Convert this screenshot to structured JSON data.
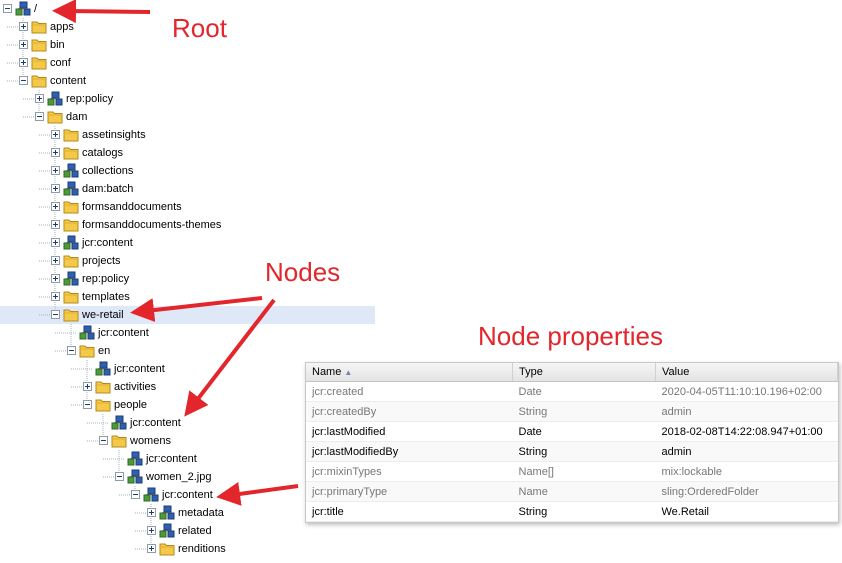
{
  "tree": {
    "nodes": [
      {
        "label": "/",
        "icon": "node-icon",
        "toggle": "minus"
      },
      {
        "label": "apps",
        "icon": "folder-icon",
        "toggle": "plus"
      },
      {
        "label": "bin",
        "icon": "folder-icon",
        "toggle": "plus"
      },
      {
        "label": "conf",
        "icon": "folder-icon",
        "toggle": "plus"
      },
      {
        "label": "content",
        "icon": "folder-icon",
        "toggle": "minus"
      },
      {
        "label": "rep:policy",
        "icon": "node-icon",
        "toggle": "plus"
      },
      {
        "label": "dam",
        "icon": "folder-icon",
        "toggle": "minus"
      },
      {
        "label": "assetinsights",
        "icon": "folder-icon",
        "toggle": "plus"
      },
      {
        "label": "catalogs",
        "icon": "folder-icon",
        "toggle": "plus"
      },
      {
        "label": "collections",
        "icon": "node-icon",
        "toggle": "plus"
      },
      {
        "label": "dam:batch",
        "icon": "node-icon",
        "toggle": "plus"
      },
      {
        "label": "formsanddocuments",
        "icon": "folder-icon",
        "toggle": "plus"
      },
      {
        "label": "formsanddocuments-themes",
        "icon": "folder-icon",
        "toggle": "plus"
      },
      {
        "label": "jcr:content",
        "icon": "node-icon",
        "toggle": "plus"
      },
      {
        "label": "projects",
        "icon": "folder-icon",
        "toggle": "plus"
      },
      {
        "label": "rep:policy",
        "icon": "node-icon",
        "toggle": "plus"
      },
      {
        "label": "templates",
        "icon": "folder-icon",
        "toggle": "plus"
      },
      {
        "label": "we-retail",
        "icon": "folder-icon",
        "toggle": "minus"
      },
      {
        "label": "jcr:content",
        "icon": "node-icon",
        "toggle": "none"
      },
      {
        "label": "en",
        "icon": "folder-icon",
        "toggle": "minus"
      },
      {
        "label": "jcr:content",
        "icon": "node-icon",
        "toggle": "none"
      },
      {
        "label": "activities",
        "icon": "folder-icon",
        "toggle": "plus"
      },
      {
        "label": "people",
        "icon": "folder-icon",
        "toggle": "minus"
      },
      {
        "label": "jcr:content",
        "icon": "node-icon",
        "toggle": "none"
      },
      {
        "label": "womens",
        "icon": "folder-icon",
        "toggle": "minus"
      },
      {
        "label": "jcr:content",
        "icon": "node-icon",
        "toggle": "none"
      },
      {
        "label": "women_2.jpg",
        "icon": "node-icon",
        "toggle": "minus"
      },
      {
        "label": "jcr:content",
        "icon": "node-icon",
        "toggle": "minus"
      },
      {
        "label": "metadata",
        "icon": "node-icon",
        "toggle": "plus"
      },
      {
        "label": "related",
        "icon": "node-icon",
        "toggle": "plus"
      },
      {
        "label": "renditions",
        "icon": "folder-icon",
        "toggle": "plus"
      }
    ]
  },
  "annotations": {
    "root": "Root",
    "nodes": "Nodes",
    "node_properties": "Node properties",
    "color": "#e2262c"
  },
  "properties": {
    "columns": {
      "name": "Name",
      "type": "Type",
      "value": "Value"
    },
    "rows": [
      {
        "name": "jcr:created",
        "type": "Date",
        "value": "2020-04-05T11:10:10.196+02:00",
        "readonly": true
      },
      {
        "name": "jcr:createdBy",
        "type": "String",
        "value": "admin",
        "readonly": true
      },
      {
        "name": "jcr:lastModified",
        "type": "Date",
        "value": "2018-02-08T14:22:08.947+01:00",
        "readonly": false
      },
      {
        "name": "jcr:lastModifiedBy",
        "type": "String",
        "value": "admin",
        "readonly": false
      },
      {
        "name": "jcr:mixinTypes",
        "type": "Name[]",
        "value": "mix:lockable",
        "readonly": true
      },
      {
        "name": "jcr:primaryType",
        "type": "Name",
        "value": "sling:OrderedFolder",
        "readonly": true
      },
      {
        "name": "jcr:title",
        "type": "String",
        "value": "We.Retail",
        "readonly": false
      }
    ]
  },
  "colors": {
    "selection": "#dfe8f6",
    "folder": "#f4c94a",
    "node_blue": "#2f5fae",
    "node_green": "#4d9a3a"
  }
}
